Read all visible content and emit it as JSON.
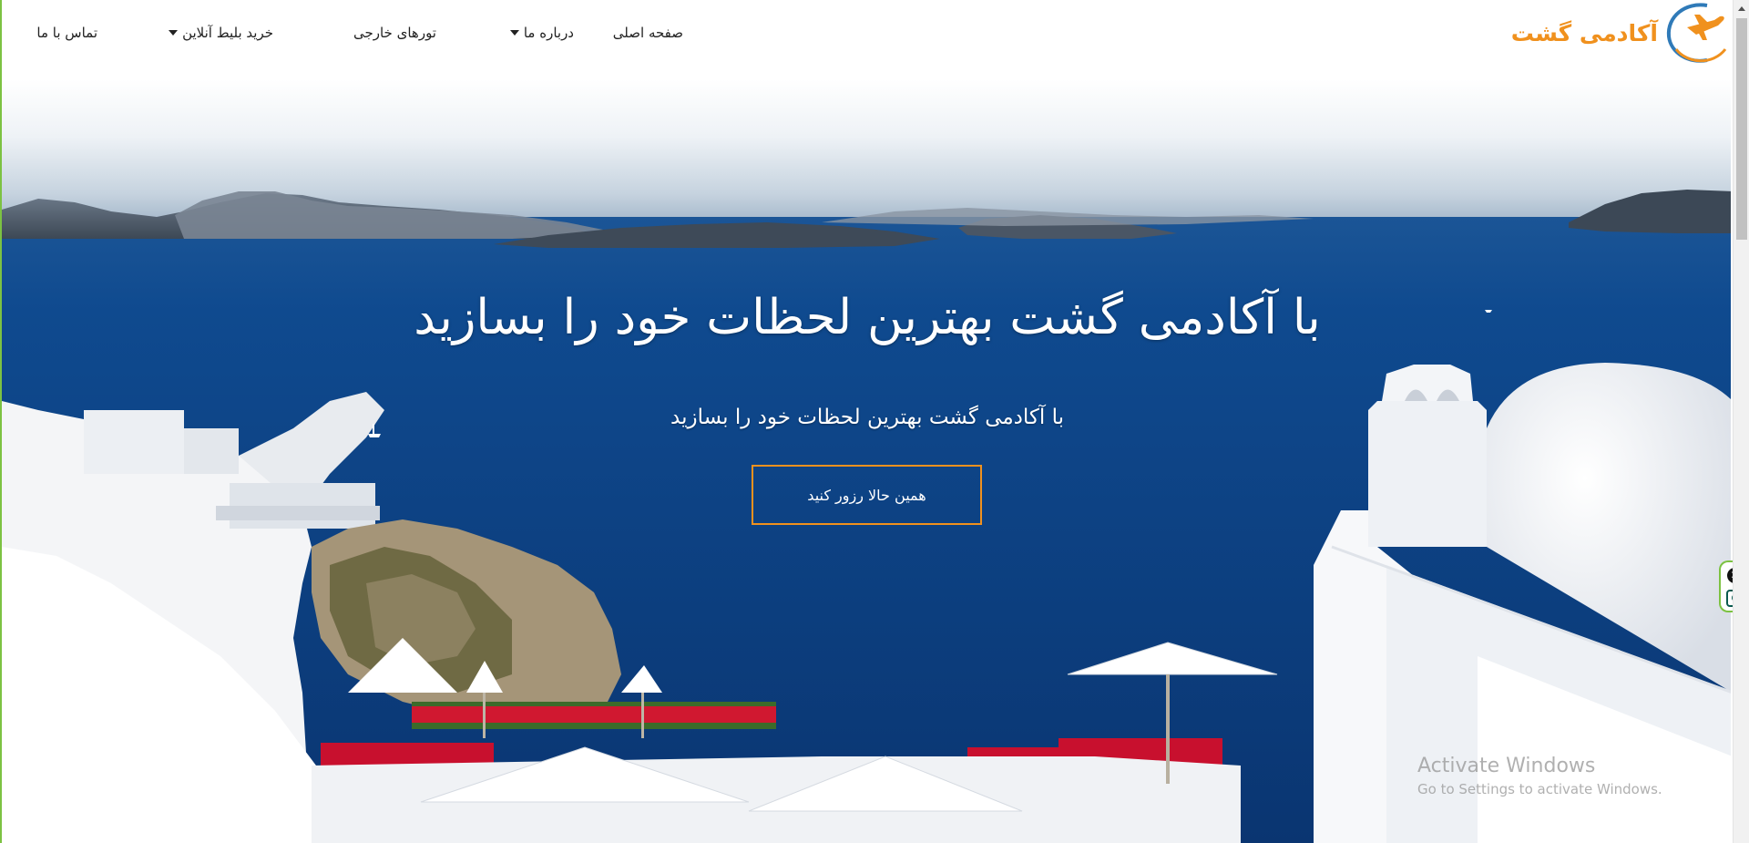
{
  "brand": {
    "name": "آکادمی گشت",
    "accent_color": "#f0911e",
    "logo_icon": "airplane-orbit-icon"
  },
  "nav": {
    "items": [
      {
        "label": "صفحه اصلی",
        "has_dropdown": false
      },
      {
        "label": "درباره ما",
        "has_dropdown": true
      },
      {
        "label": "تورهای خارجی",
        "has_dropdown": false
      },
      {
        "label": "خرید بلیط آنلاین",
        "has_dropdown": true
      },
      {
        "label": "تماس با ما",
        "has_dropdown": false
      }
    ]
  },
  "hero": {
    "title": "با آکادمی گشت بهترین لحظات خود را بسازید",
    "subtitle": "با آکادمی گشت بهترین لحظات خود را بسازید",
    "cta_label": "همین حالا رزور کنید",
    "cta_border_color": "#f0911e"
  },
  "watermark": {
    "line1": "Activate Windows",
    "line2": "Go to Settings to activate Windows."
  },
  "widget": {
    "close_glyph": "✕",
    "e_glyph": "e",
    "border_color": "#7cc242"
  }
}
